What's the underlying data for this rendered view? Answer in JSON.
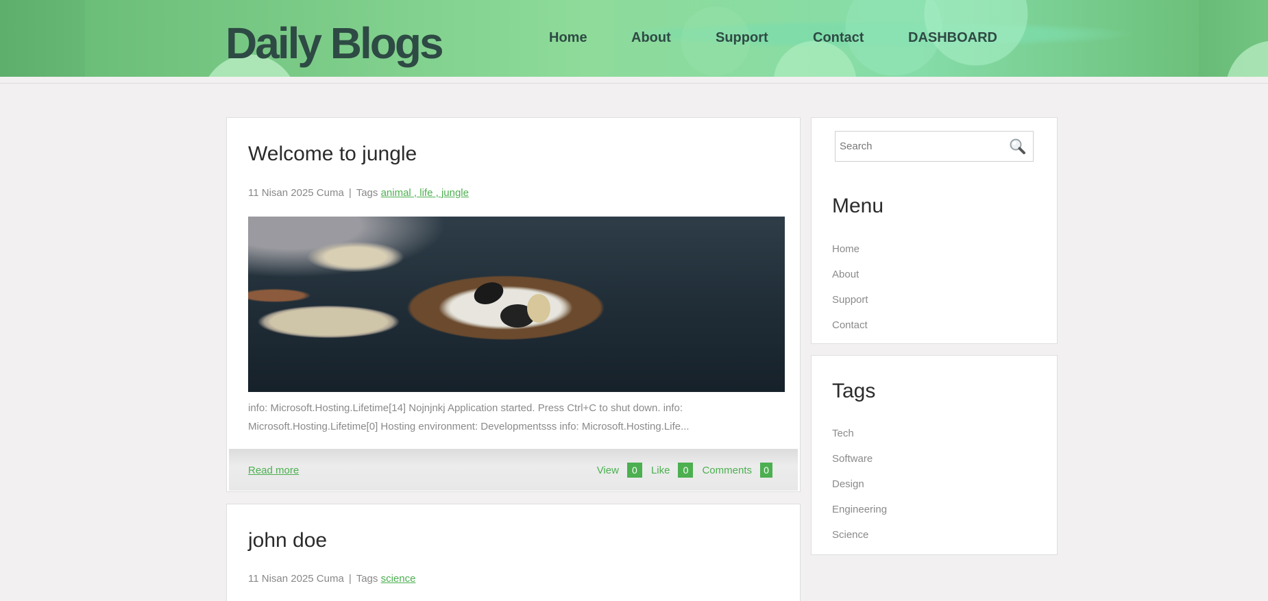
{
  "header": {
    "logo": "Daily Blogs",
    "nav": [
      "Home",
      "About",
      "Support",
      "Contact",
      "DASHBOARD"
    ]
  },
  "posts": [
    {
      "title": "Welcome to jungle",
      "date": "11 Nisan 2025 Cuma",
      "tags_label": "Tags",
      "tags": "animal , life , jungle",
      "excerpt": "info: Microsoft.Hosting.Lifetime[14] Nojnjnkj Application started. Press Ctrl+C to shut down. info: Microsoft.Hosting.Lifetime[0] Hosting environment: Developmentsss info: Microsoft.Hosting.Life...",
      "read_more": "Read more",
      "view_label": "View",
      "view_count": "0",
      "like_label": "Like",
      "like_count": "0",
      "comments_label": "Comments",
      "comments_count": "0"
    },
    {
      "title": "john doe",
      "date": "11 Nisan 2025 Cuma",
      "tags_label": "Tags",
      "tags": "science"
    }
  ],
  "sidebar": {
    "search_placeholder": "Search",
    "menu_title": "Menu",
    "menu_items": [
      "Home",
      "About",
      "Support",
      "Contact"
    ],
    "tags_title": "Tags",
    "tag_items": [
      "Tech",
      "Software",
      "Design",
      "Engineering",
      "Science"
    ]
  },
  "colors": {
    "accent": "#4caf50",
    "header_green": "#6cc07a",
    "logo_text": "#2e4a44"
  }
}
